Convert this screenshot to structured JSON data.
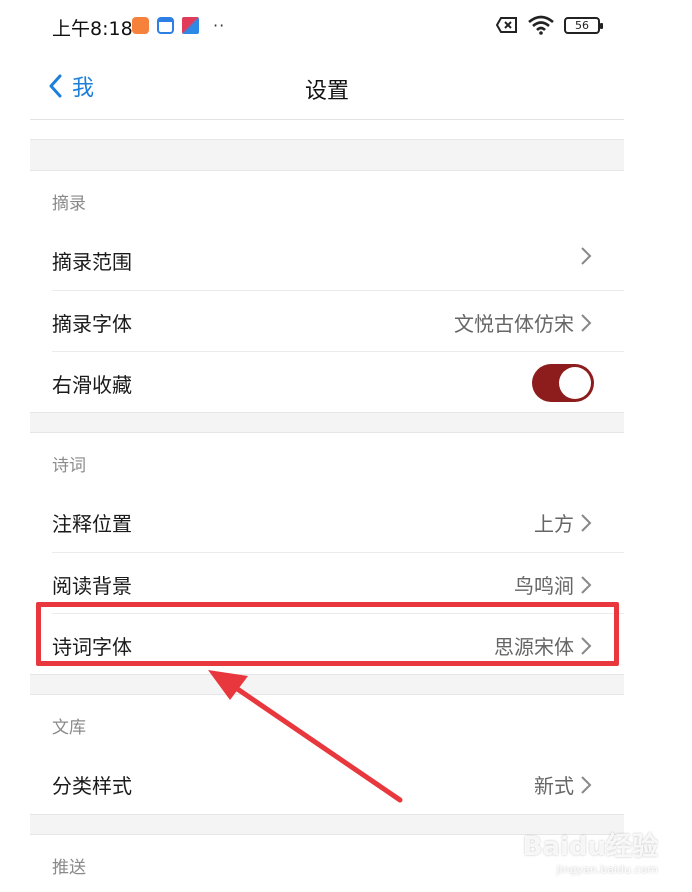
{
  "status_bar": {
    "time": "上午8:18",
    "battery": "56",
    "icons": [
      "app-icon-orange",
      "calendar-icon",
      "app-icon-colorful",
      "more-dots-icon",
      "sim-x-icon",
      "wifi-icon",
      "battery-icon"
    ]
  },
  "nav": {
    "back_label": "我",
    "title": "设置"
  },
  "sections": {
    "excerpt": {
      "header": "摘录",
      "range_label": "摘录范围",
      "font_label": "摘录字体",
      "font_value": "文悦古体仿宋",
      "swipe_label": "右滑收藏",
      "swipe_enabled": true
    },
    "poetry": {
      "header": "诗词",
      "annotation_label": "注释位置",
      "annotation_value": "上方",
      "background_label": "阅读背景",
      "background_value": "鸟鸣涧",
      "font_label": "诗词字体",
      "font_value": "思源宋体"
    },
    "library": {
      "header": "文库",
      "category_label": "分类样式",
      "category_value": "新式"
    },
    "push": {
      "header": "推送"
    }
  },
  "watermark": {
    "brand": "Baidu经验",
    "domain": "jingyan.baidu.com"
  },
  "colors": {
    "accent_blue": "#1e7fd8",
    "toggle_on": "#8d1d1d",
    "highlight_red": "#e8383d"
  }
}
